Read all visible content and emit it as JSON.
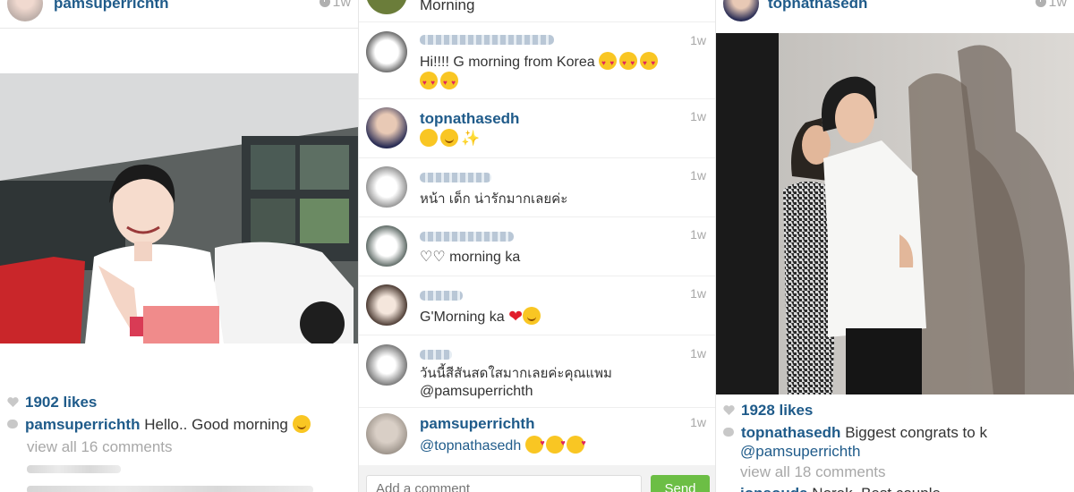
{
  "post_left": {
    "username": "pamsuperrichth",
    "time": "1w",
    "likes": "1902 likes",
    "caption_user": "pamsuperrichth",
    "caption_text": "Hello.. Good morning",
    "view_all": "view all 16 comments"
  },
  "comments_view": {
    "top_partial_text": "Morning",
    "comments": [
      {
        "user": "",
        "text": "Hi!!!! G morning from Korea",
        "time": "1w"
      },
      {
        "user": "topnathasedh",
        "text": "",
        "time": "1w"
      },
      {
        "user": "",
        "text": "หน้า เด็ก  น่ารักมากเลยค่ะ",
        "time": "1w"
      },
      {
        "user": "",
        "text": "♡♡ morning ka",
        "time": "1w"
      },
      {
        "user": "",
        "text": "G'Morning ka",
        "time": "1w"
      },
      {
        "user": "",
        "text": "วันนี้สีสันสดใสมากเลยค่ะคุณแพม",
        "text2": "@pamsuperrichth",
        "time": "1w"
      },
      {
        "user": "pamsuperrichth",
        "text": "@topnathasedh",
        "time": "1w"
      }
    ],
    "add_comment_placeholder": "Add a comment",
    "send_label": "Send"
  },
  "post_right": {
    "username": "topnathasedh",
    "time": "1w",
    "likes": "1928 likes",
    "caption_user": "topnathasedh",
    "caption_text": "Biggest congrats to k",
    "caption_mention": "@pamsuperrichth",
    "view_all": "view all 18 comments",
    "bottom_partial_user": "jonsouda",
    "bottom_partial_text": "Norak. Best couple"
  },
  "colors": {
    "username": "#1f5b8a",
    "muted": "#a8a8a8",
    "send_button": "#6cbe45"
  }
}
